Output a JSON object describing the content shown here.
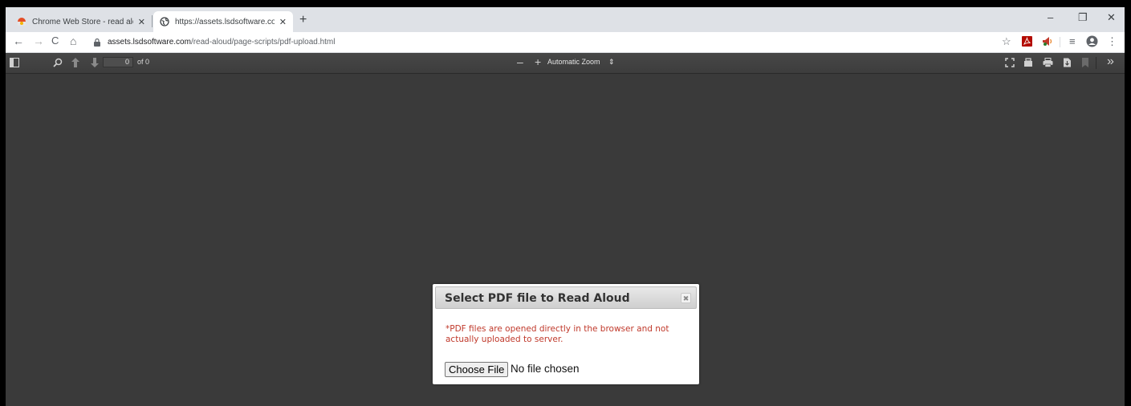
{
  "tabs": [
    {
      "title": "Chrome Web Store - read aloud",
      "close": "✕",
      "icon": "chrome-web-store-icon"
    },
    {
      "title": "https://assets.lsdsoftware.com/re",
      "close": "✕",
      "icon": "globe-icon"
    }
  ],
  "new_tab": "+",
  "window_controls": {
    "minimize": "–",
    "restore": "❐",
    "close": "✕"
  },
  "nav": {
    "back": "←",
    "forward": "→",
    "reload": "C",
    "home": "⌂"
  },
  "address": {
    "domain": "assets.lsdsoftware.com",
    "path": "/read-aloud/page-scripts/pdf-upload.html"
  },
  "extensions": {
    "star": "☆",
    "profile": "●",
    "menu": "⋮",
    "queue": "≡"
  },
  "pdf_toolbar": {
    "page_value": "0",
    "page_count": "of 0",
    "zoom_out": "–",
    "zoom_in": "+",
    "zoom_label": "Automatic Zoom",
    "zoom_arrow": "⇕",
    "more": "»"
  },
  "dialog": {
    "title": "Select PDF file to Read Aloud",
    "close": "✖",
    "note": "*PDF files are opened directly in the browser and not actually uploaded to server.",
    "choose_label": "Choose File",
    "file_status": "No file chosen"
  },
  "colors": {
    "viewer_bg": "#3a3a3a",
    "note_red": "#c0392b",
    "tabstrip": "#dee1e6"
  }
}
